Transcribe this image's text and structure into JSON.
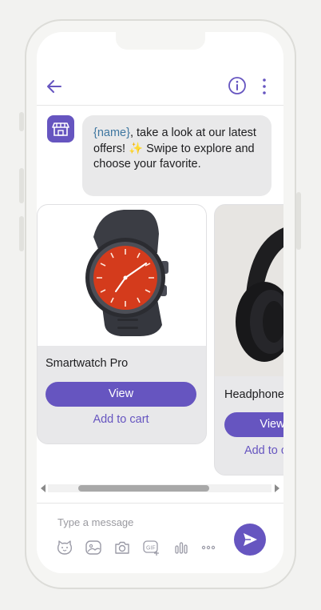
{
  "header": {
    "back_icon": "arrow-left-icon",
    "info_icon": "info-circle-icon",
    "more_icon": "vertical-dots-icon"
  },
  "message": {
    "avatar_icon": "storefront-icon",
    "name_token": "{name}",
    "text_after_name": ", take a look at our latest offers! ",
    "emoji": "✨",
    "text_tail": " Swipe to explore and choose your favorite."
  },
  "products": [
    {
      "title": "Smartwatch Pro",
      "view_label": "View",
      "add_label": "Add to cart",
      "image": "smartwatch-image"
    },
    {
      "title": "Headphones",
      "view_label": "View",
      "add_label": "Add to cart",
      "image": "headphones-image"
    }
  ],
  "composer": {
    "placeholder": "Type a message",
    "tools": [
      "emoji-icon",
      "sticker-icon",
      "camera-icon",
      "gif-icon",
      "chart-icon",
      "more-horizontal-icon"
    ],
    "send_icon": "send-icon"
  },
  "colors": {
    "accent": "#6655c0",
    "bubble": "#e9e9ea",
    "name_token": "#3e76a0"
  }
}
